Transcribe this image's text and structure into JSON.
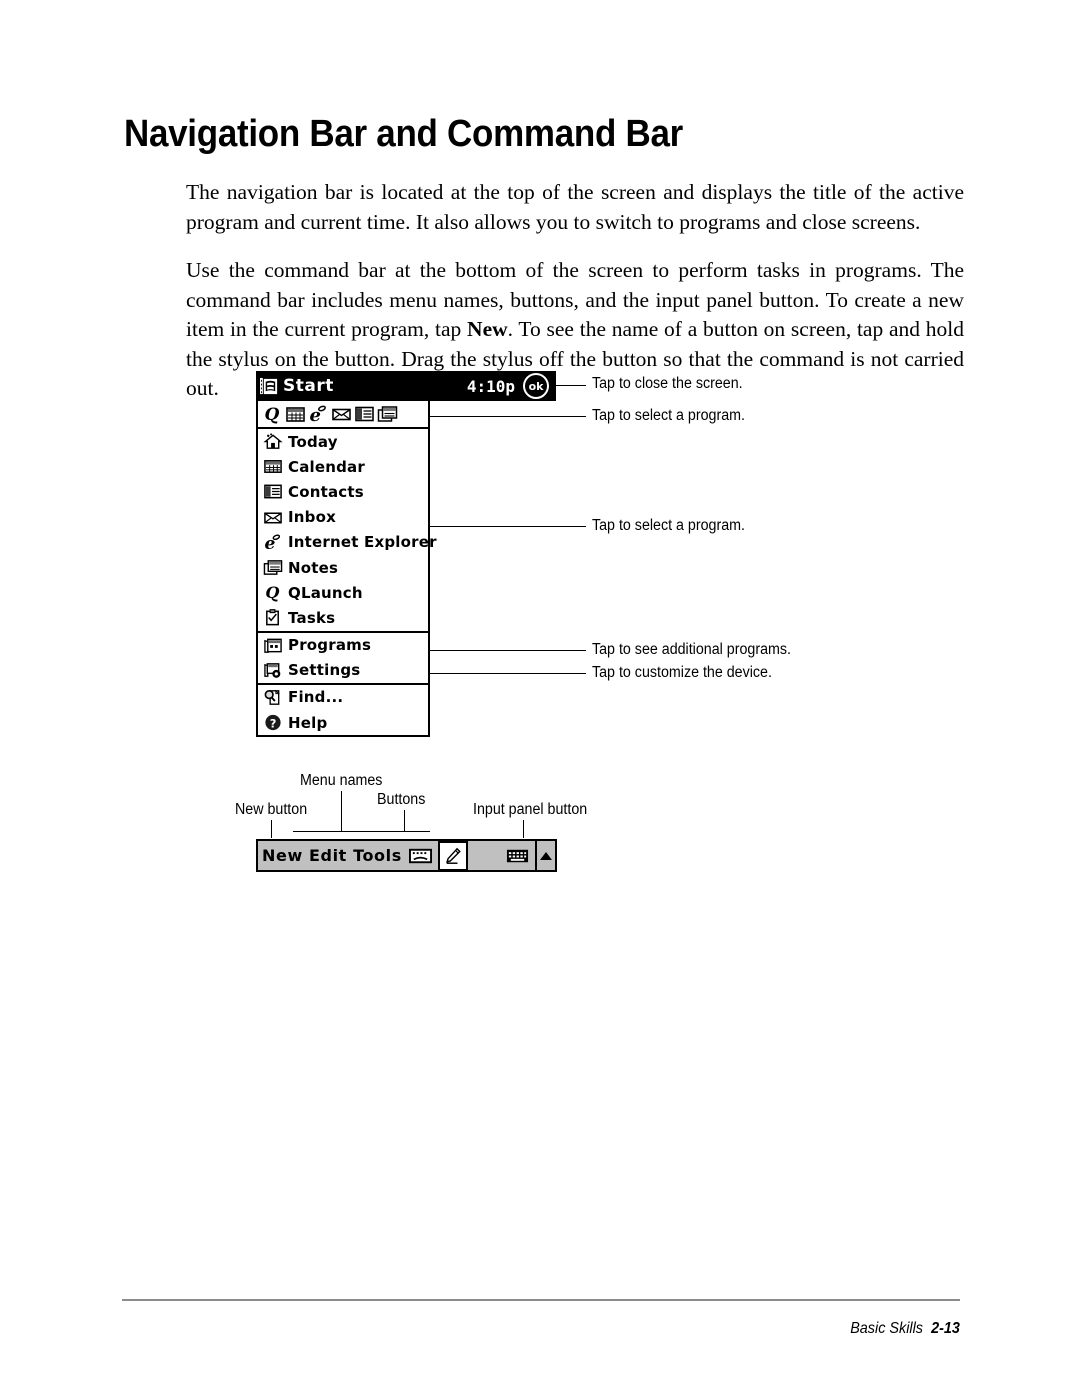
{
  "page": {
    "title": "Navigation Bar and Command Bar",
    "paragraphs": [
      "The navigation bar is located at the top of the screen and displays the title of the active program and current time. It also allows you to switch to programs and close screens.",
      "Use the command bar at the bottom of the screen to perform tasks in programs. The command bar includes menu names, buttons, and the input panel button. To create a new item in the current program, tap ",
      ". To see the name of a button on screen, tap and hold the stylus on the button. Drag the stylus off the button so that the command is not carried out."
    ],
    "bold_word": "New"
  },
  "navbar": {
    "start_label": "Start",
    "clock": "4:10p",
    "ok_label": "ok",
    "icon": "windows-flag-icon"
  },
  "quick_launch": {
    "icons": [
      "qlaunch-icon",
      "calendar-icon",
      "internet-explorer-icon",
      "inbox-icon",
      "contacts-icon",
      "notes-icon"
    ]
  },
  "start_menu": {
    "groups": [
      {
        "items": [
          {
            "label": "Today",
            "icon": "today-house-icon"
          },
          {
            "label": "Calendar",
            "icon": "calendar-icon"
          },
          {
            "label": "Contacts",
            "icon": "contacts-icon"
          },
          {
            "label": "Inbox",
            "icon": "inbox-envelope-icon"
          },
          {
            "label": "Internet Explorer",
            "icon": "internet-explorer-icon"
          },
          {
            "label": "Notes",
            "icon": "notes-icon"
          },
          {
            "label": "QLaunch",
            "icon": "qlaunch-icon"
          },
          {
            "label": "Tasks",
            "icon": "tasks-checklist-icon"
          }
        ]
      },
      {
        "items": [
          {
            "label": "Programs",
            "icon": "programs-folder-icon"
          },
          {
            "label": "Settings",
            "icon": "settings-gear-icon"
          }
        ]
      },
      {
        "items": [
          {
            "label": "Find...",
            "icon": "find-magnifier-icon"
          },
          {
            "label": "Help",
            "icon": "help-question-icon"
          }
        ]
      }
    ]
  },
  "callouts": {
    "close_screen": "Tap to close the screen.",
    "select_program_top": "Tap to select a program.",
    "select_program_menu": "Tap to select a program.",
    "additional_programs": "Tap to see additional programs.",
    "customize_device": "Tap to customize the device."
  },
  "command_bar": {
    "menu_names": "New Edit Tools",
    "labels": {
      "new_button": "New button",
      "menu_names": "Menu names",
      "buttons": "Buttons",
      "input_panel_button": "Input panel button"
    },
    "icons": [
      "recording-button-icon",
      "pen-draw-button-icon",
      "keyboard-input-panel-icon",
      "input-panel-chevron-up-icon"
    ]
  },
  "footer": {
    "section": "Basic Skills",
    "page_number": "2-13"
  }
}
